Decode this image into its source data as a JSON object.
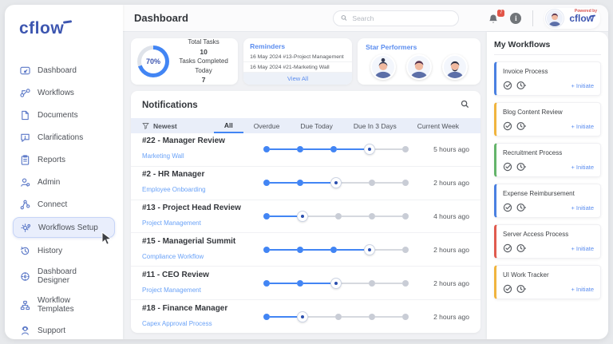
{
  "app": {
    "brand": "cflow",
    "powered_by": "Powered by"
  },
  "colors": {
    "accent_blue": "#4285f4",
    "logo_blue": "#3d56b0",
    "link_blue": "#6aa2f7",
    "title_blue": "#5b8def",
    "badge_red": "#e25548",
    "tab_bar_bg": "#e9eef9"
  },
  "icons": {
    "search": "magnifier",
    "bell": "bell",
    "info": "i-circle",
    "filter": "funnel",
    "approve": "check-circle",
    "pending": "clock",
    "cursor": "pointer-arrow"
  },
  "sidebar": {
    "items": [
      {
        "label": "Dashboard"
      },
      {
        "label": "Workflows"
      },
      {
        "label": "Documents"
      },
      {
        "label": "Clarifications"
      },
      {
        "label": "Reports"
      },
      {
        "label": "Admin"
      },
      {
        "label": "Connect"
      },
      {
        "label": "Workflows Setup",
        "active": true
      },
      {
        "label": "History"
      },
      {
        "label": "Dashboard Designer"
      },
      {
        "label": "Workflow Templates"
      },
      {
        "label": "Support"
      }
    ]
  },
  "header": {
    "title": "Dashboard",
    "search_placeholder": "Search",
    "notification_count": "7"
  },
  "summary": {
    "tasks": {
      "percent": "70%",
      "total_label": "Total Tasks",
      "total": "10",
      "completed_label": "Tasks Completed Today",
      "completed": "7"
    },
    "reminders": {
      "title": "Reminders",
      "items": [
        {
          "text": "16 May 2024 #13-Project Management"
        },
        {
          "text": "16 May 2024 #21-Marketing Wall"
        }
      ],
      "view_all": "View All"
    },
    "star_performers": {
      "title": "Star Performers"
    }
  },
  "notifications": {
    "title": "Notifications",
    "sort_label": "Newest",
    "tabs": [
      "All",
      "Overdue",
      "Due Today",
      "Due In 3 Days",
      "Current Week"
    ],
    "active_tab": "All",
    "rows": [
      {
        "title": "#22 - Manager Review",
        "workflow": "Marketing Wall",
        "time": "5 hours ago",
        "steps": 5,
        "current": 3
      },
      {
        "title": "#2 - HR Manager",
        "workflow": "Employee Onboarding",
        "time": "2 hours ago",
        "steps": 5,
        "current": 2
      },
      {
        "title": "#13 - Project Head Review",
        "workflow": "Project Management",
        "time": "4 hours ago",
        "steps": 5,
        "current": 1
      },
      {
        "title": "#15 - Managerial Summit",
        "workflow": "Compliance Workflow",
        "time": "2 hours ago",
        "steps": 5,
        "current": 3
      },
      {
        "title": "#11 - CEO Review",
        "workflow": "Project Management",
        "time": "2 hours ago",
        "steps": 5,
        "current": 2
      },
      {
        "title": "#18 - Finance Manager",
        "workflow": "Capex Approval Process",
        "time": "2 hours ago",
        "steps": 5,
        "current": 1
      }
    ]
  },
  "my_workflows": {
    "title": "My Workflows",
    "initiate_label": "+ Initiate",
    "items": [
      {
        "name": "Invoice Process",
        "accent": "#4a80e1"
      },
      {
        "name": "Blog Content Review",
        "accent": "#f0b43e"
      },
      {
        "name": "Recruitment Process",
        "accent": "#64b46a"
      },
      {
        "name": "Expense Reimbursement",
        "accent": "#4a80e1"
      },
      {
        "name": "Server Access Process",
        "accent": "#e05a4e"
      },
      {
        "name": "UI Work Tracker",
        "accent": "#f0b43e"
      }
    ]
  }
}
